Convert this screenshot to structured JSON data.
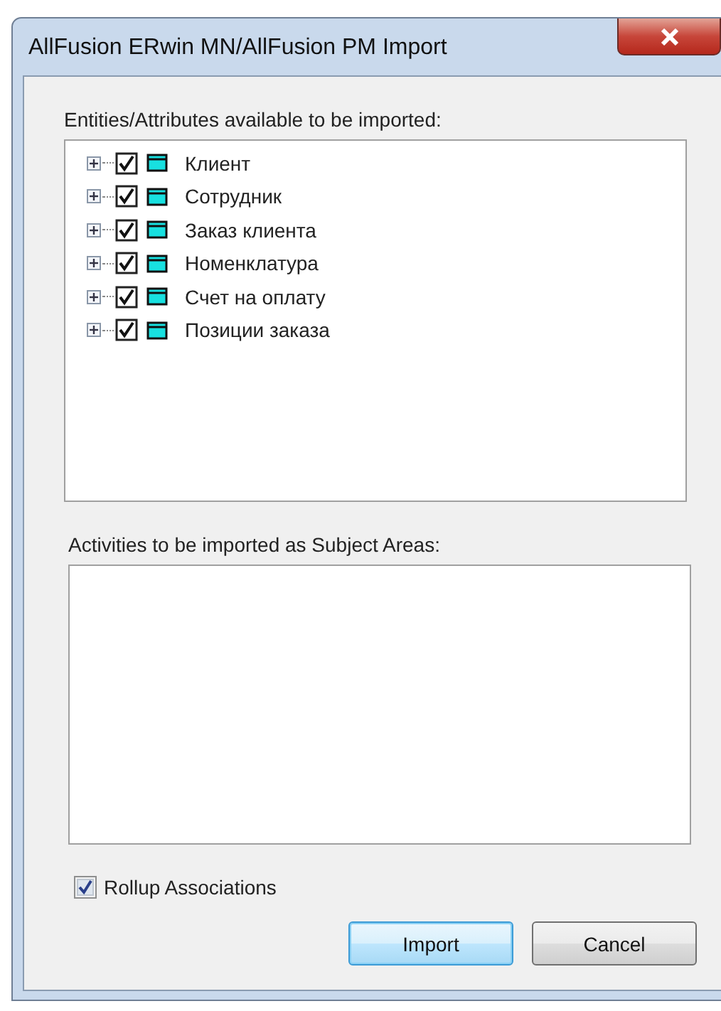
{
  "window": {
    "title": "AllFusion ERwin MN/AllFusion PM Import"
  },
  "entities": {
    "label": "Entities/Attributes available to be imported:",
    "items": [
      {
        "label": "Клиент",
        "checked": true,
        "expanded": false
      },
      {
        "label": "Сотрудник",
        "checked": true,
        "expanded": false
      },
      {
        "label": "Заказ клиента",
        "checked": true,
        "expanded": false
      },
      {
        "label": "Номенклатура",
        "checked": true,
        "expanded": false
      },
      {
        "label": "Счет на оплату",
        "checked": true,
        "expanded": false
      },
      {
        "label": "Позиции заказа",
        "checked": true,
        "expanded": false
      }
    ]
  },
  "activities": {
    "label": "Activities to be imported as Subject Areas:"
  },
  "rollup": {
    "label": "Rollup Associations",
    "checked": true
  },
  "buttons": [
    {
      "label": "Import",
      "default": true
    },
    {
      "label": "Cancel",
      "default": false
    }
  ]
}
